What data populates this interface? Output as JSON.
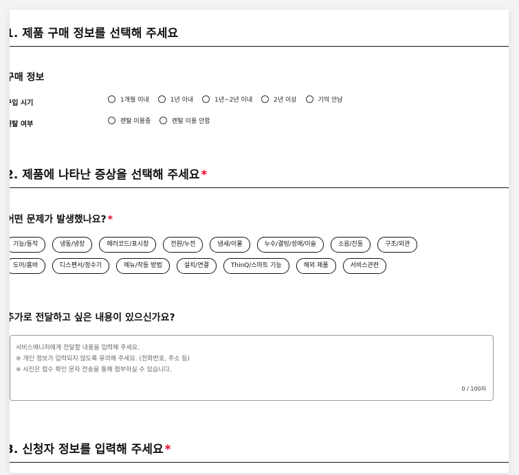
{
  "section1": {
    "title": "1. 제품 구매 정보를 선택해 주세요",
    "subtitle": "구매 정보",
    "purchase_label": "구입 시기",
    "purchase_options": [
      "1개월 이내",
      "1년 이내",
      "1년~2년 이내",
      "2년 이상",
      "기억 안남"
    ],
    "rental_label": "렌탈 여부",
    "rental_options": [
      "렌탈 이용중",
      "렌탈 이용 안함"
    ]
  },
  "section2": {
    "title": "2. 제품에 나타난 증상을 선택해 주세요",
    "question": "어떤 문제가 발생했나요?",
    "symptoms_row1": [
      "기능/동작",
      "냉동/냉장",
      "에러코드/표시창",
      "전원/누전",
      "냄새/이물",
      "누수/결빙/성에/이슬",
      "소음/진동",
      "구조/외관"
    ],
    "symptoms_row2": [
      "도어/홈바",
      "디스펜서/정수기",
      "메뉴/작동 방법",
      "설치/연결",
      "ThinQ/스마트 기능",
      "해외 제품",
      "서비스관련"
    ],
    "extra_question": "추가로 전달하고 싶은 내용이 있으신가요?",
    "textarea_placeholder": [
      "서비스매니저에게 전달할 내용을 입력해 주세요.",
      "※ 개인 정보가 입력되지 않도록 유의해 주세요. (전화번호, 주소 등)",
      "※ 사진은 접수 확인 문자 전송을 통해 첨부하실 수 있습니다."
    ],
    "counter": "0 / 100자"
  },
  "section3": {
    "title": "3. 신청자 정보를 입력해 주세요"
  },
  "required_mark": "*",
  "colors": {
    "required": "#e4002b",
    "border": "#111111"
  }
}
